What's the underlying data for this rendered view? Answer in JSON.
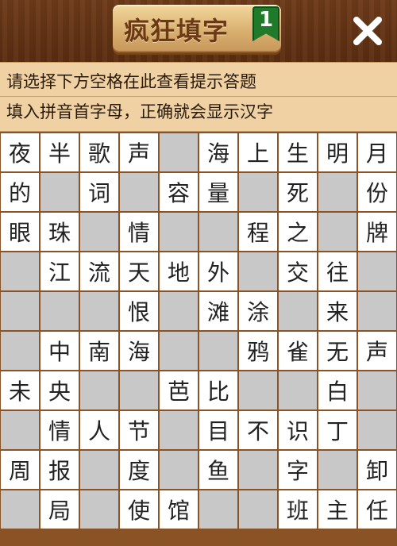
{
  "header": {
    "title": "疯狂填字",
    "level": "1",
    "close_icon": "close-x-icon"
  },
  "hints": {
    "line1": "请选择下方空格在此查看提示答题",
    "line2": "填入拼音首字母，正确就会显示汉字"
  },
  "grid": {
    "cols": 10,
    "rows": 10,
    "colors": {
      "white": "#ffffff",
      "gray": "#c8c8c8",
      "border": "#8a5325"
    },
    "cells": [
      [
        "夜",
        "半",
        "歌",
        "声",
        "#",
        "海",
        "上",
        "生",
        "明",
        "月"
      ],
      [
        "的",
        "#",
        "词",
        "#",
        "容",
        "量",
        "#",
        "死",
        "#",
        "份"
      ],
      [
        "眼",
        "珠",
        "#",
        "情",
        "#",
        "#",
        "程",
        "之",
        "#",
        "牌"
      ],
      [
        "#",
        "江",
        "流",
        "天",
        "地",
        "外",
        "#",
        "交",
        "往",
        "#"
      ],
      [
        "#",
        "#",
        "#",
        "恨",
        "#",
        "滩",
        "涂",
        "#",
        "来",
        "#"
      ],
      [
        "#",
        "中",
        "南",
        "海",
        "#",
        "#",
        "鸦",
        "雀",
        "无",
        "声"
      ],
      [
        "未",
        "央",
        "#",
        "#",
        "芭",
        "比",
        "#",
        "#",
        "白",
        "#"
      ],
      [
        "#",
        "情",
        "人",
        "节",
        "#",
        "目",
        "不",
        "识",
        "丁",
        "#"
      ],
      [
        "周",
        "报",
        "#",
        "度",
        "#",
        "鱼",
        "#",
        "字",
        "#",
        "卸"
      ],
      [
        "#",
        "局",
        "#",
        "使",
        "馆",
        "#",
        "#",
        "班",
        "主",
        "任"
      ]
    ]
  }
}
